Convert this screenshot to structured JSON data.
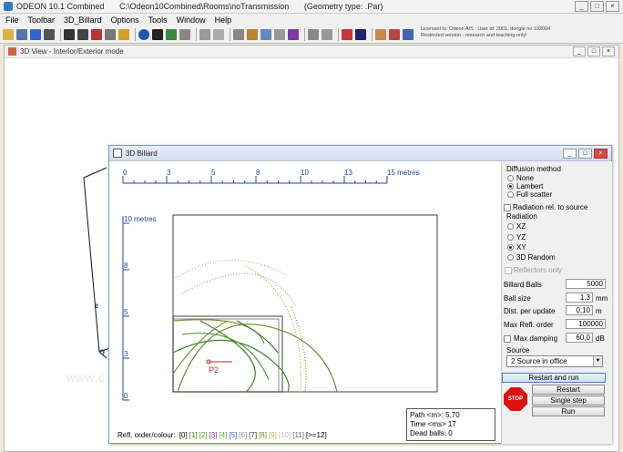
{
  "window": {
    "title_parts": [
      "ODEON 10.1 Combined",
      "C:\\Odeon10Combined\\Rooms\\noTransmission",
      "(Geometry type: .Par)"
    ],
    "buttons": [
      "_",
      "□",
      "×"
    ]
  },
  "menu": [
    "File",
    "Toolbar",
    "3D_Billard",
    "Options",
    "Tools",
    "Window",
    "Help"
  ],
  "license": [
    "Licensed to: Odeon A/S : User id: 2001, dongle no 102004",
    "Restricted version - research and teaching only!"
  ],
  "view3d": {
    "title": "3D View - Interior/Exterior mode",
    "watermark": "www.c",
    "axis_z": "z",
    "axis_o": "o"
  },
  "billard": {
    "title": "3D Billard",
    "x_ticks": [
      "0",
      "3",
      "5",
      "8",
      "10",
      "13",
      "15 metres"
    ],
    "y_ticks": [
      "10 metres",
      "8",
      "5",
      "3",
      "0"
    ],
    "source_label": "P2",
    "legend_prefix": "Refl. order/colour:",
    "legend_items": [
      {
        "label": "[0]",
        "color": "#000000"
      },
      {
        "label": "[1]",
        "color": "#2e8b2e"
      },
      {
        "label": "[2]",
        "color": "#5a9a3a"
      },
      {
        "label": "[3]",
        "color": "#8a3fa8"
      },
      {
        "label": "[4]",
        "color": "#5aaa5a"
      },
      {
        "label": "[5]",
        "color": "#4466cc"
      },
      {
        "label": "[6]",
        "color": "#8888aa"
      },
      {
        "label": "[7]",
        "color": "#333333"
      },
      {
        "label": "[8]",
        "color": "#6a8a2a"
      },
      {
        "label": "[9]",
        "color": "#c8b04a"
      },
      {
        "label": "[10]",
        "color": "#c0c0c0"
      },
      {
        "label": "[11]",
        "color": "#666666"
      },
      {
        "label": "[>=12]",
        "color": "#000000"
      }
    ],
    "info": {
      "path": "Path <m>: 5,70",
      "time": "Time <ms> 17",
      "dead": "Dead balls: 0"
    }
  },
  "panel": {
    "diffusion_title": "Diffusion method",
    "diffusion_options": [
      "None",
      "Lambert",
      "Full scatter"
    ],
    "diffusion_selected": 1,
    "radiation_rel": "Radiation rel. to source",
    "radiation_title": "Radiation",
    "radiation_options": [
      "XZ",
      "YZ",
      "XY",
      "3D Random"
    ],
    "radiation_selected": 2,
    "reflectors_only": "Reflectors only",
    "billard_balls_label": "Billard Balls",
    "billard_balls_value": "5000",
    "ball_size_label": "Ball size",
    "ball_size_value": "1,3",
    "ball_size_unit": "mm",
    "dist_label": "Dist. per update",
    "dist_value": "0,10",
    "dist_unit": "m",
    "max_refl_label": "Max Refl. order",
    "max_refl_value": "100000",
    "max_damping_label": "Max damping",
    "max_damping_value": "60,0",
    "max_damping_unit": "dB",
    "source_title": "Source",
    "source_value": "2 Source in office",
    "btn_restart_run": "Restart and run",
    "btn_restart": "Restart",
    "btn_single_step": "Single step",
    "btn_run": "Run",
    "stop_label": "STOP"
  }
}
